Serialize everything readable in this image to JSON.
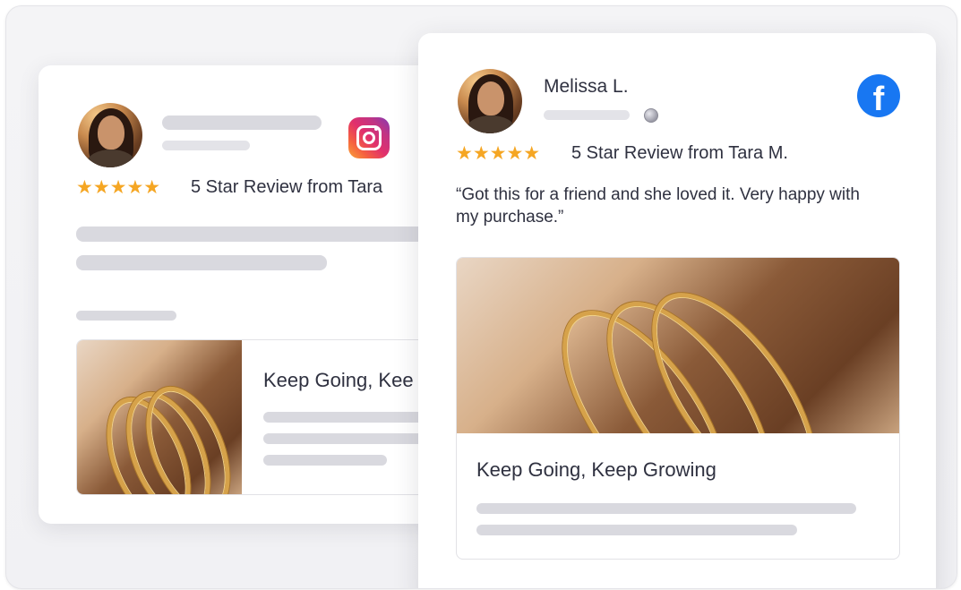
{
  "back_card": {
    "network_icon": "instagram-icon",
    "rating_stars": "★★★★★",
    "rating": 5,
    "review_title": "5 Star Review from Tara",
    "product_title": "Keep Going, Kee"
  },
  "front_card": {
    "reviewer_name": "Melissa L.",
    "network_icon": "facebook-icon",
    "visibility_icon": "globe-icon",
    "rating_stars": "★★★★★",
    "rating": 5,
    "review_title": "5 Star Review from Tara M.",
    "quote": "“Got this for a friend and she loved it. Very happy with my purchase.”",
    "product_title": "Keep Going, Keep Growing"
  },
  "colors": {
    "star": "#f5a623",
    "facebook": "#1877f2",
    "placeholder_bar": "#d9d9df"
  }
}
